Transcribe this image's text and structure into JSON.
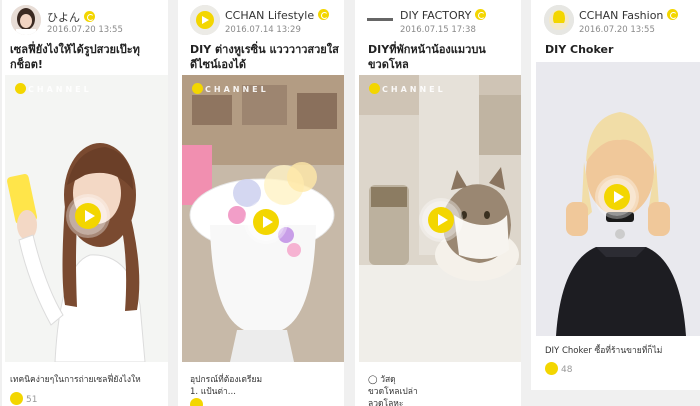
{
  "cards": [
    {
      "author": "ひよん",
      "date": "2016.07.20 13:55",
      "title": "เซลฟี่ยังไงให้ได้รูปสวยเป๊ะทุกช็อต!",
      "watermark": "CHANNEL",
      "description": "เทคนิคง่ายๆในการถ่ายเซลฟี่ยังไงให",
      "likes": "51",
      "verified_icon": "verified-badge-icon",
      "accent": "#f3d600"
    },
    {
      "author": "CCHAN Lifestyle",
      "date": "2016.07.14 13:29",
      "title": "DIY ต่างหูเรซิ่น แวววาวสวยใสดีไซน์เองได้",
      "watermark": "CHANNEL",
      "description": "อุปกรณ์ที่ต้องเตรียม\n1. แป้นต่า...",
      "likes": ""
    },
    {
      "author": "DIY FACTORY",
      "date": "2016.07.15 17:38",
      "title": "DIYที่พักหน้าน้องแมวบนขวดโหล",
      "watermark": "CHANNEL",
      "description": "◯ วัสดุ\nขวดโหลเปล่า\nลวดโลหะ",
      "likes": ""
    },
    {
      "author": "CCHAN Fashion",
      "date": "2016.07.20 13:55",
      "title": "DIY Choker",
      "watermark": "",
      "description": "DIY Choker ซื้อที่ร้านขายที่ก็ไม่",
      "likes": "48"
    }
  ]
}
